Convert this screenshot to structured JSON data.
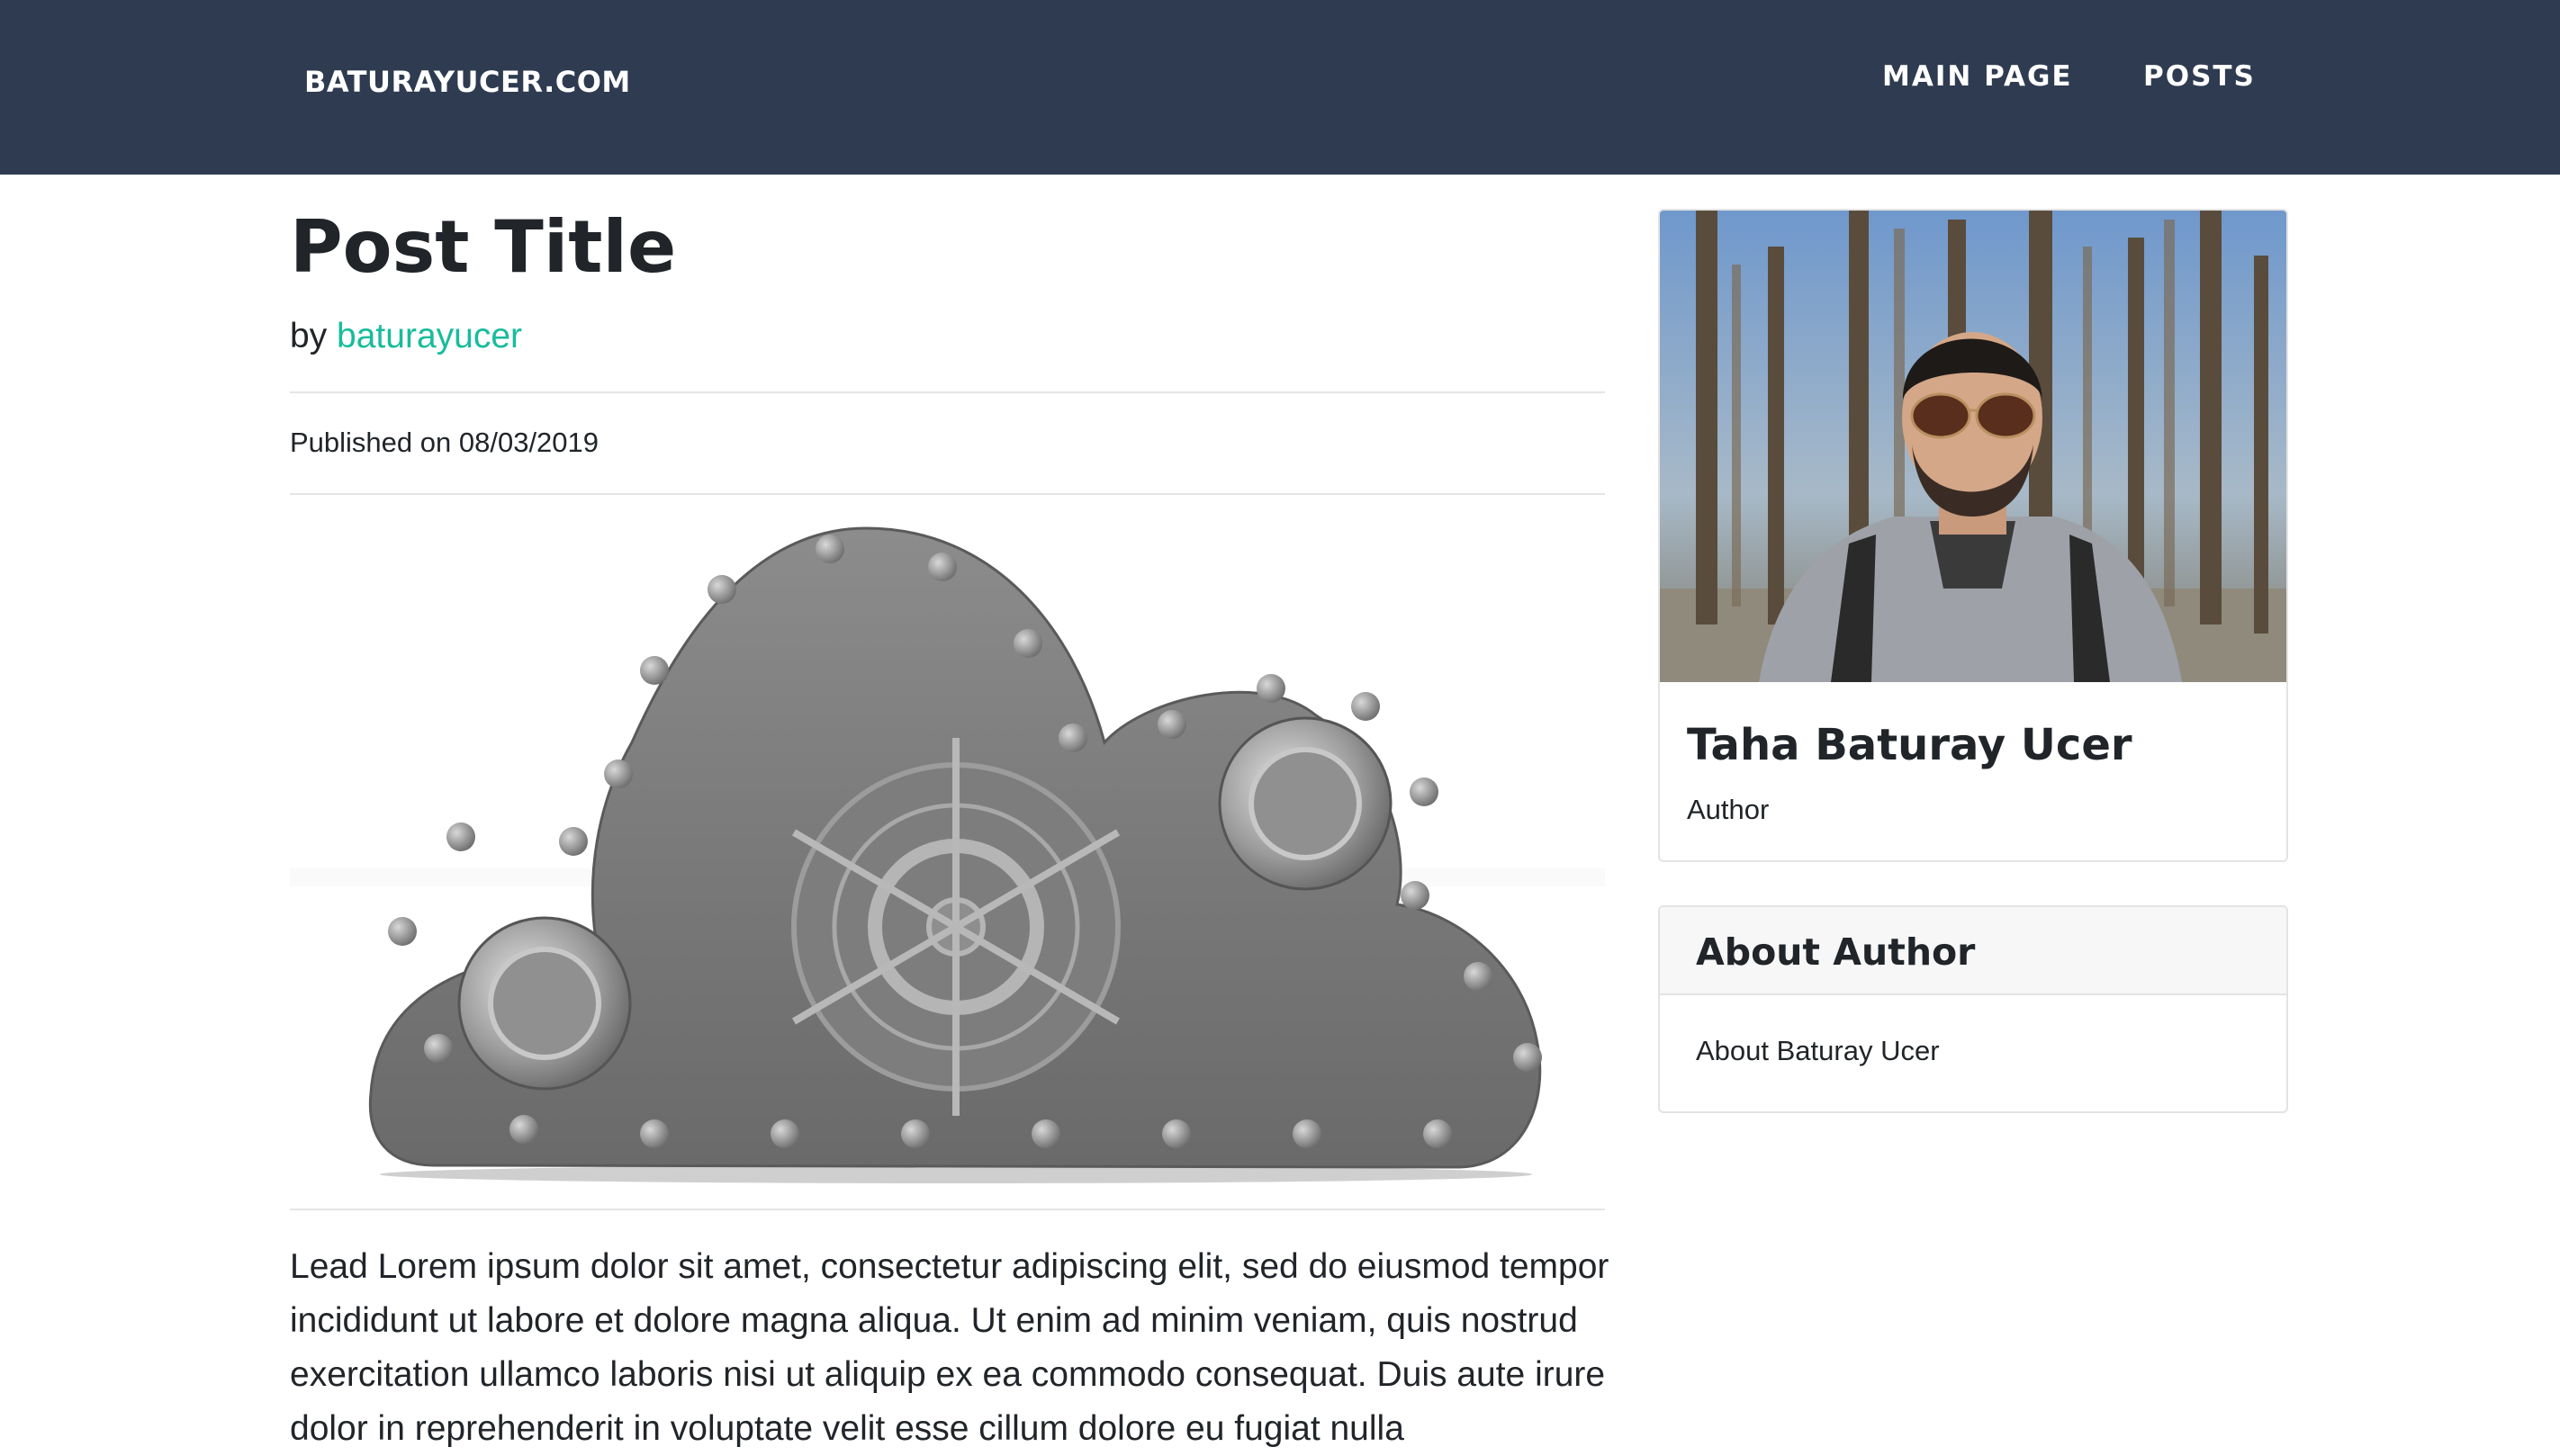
{
  "navbar": {
    "brand": "BATURAYUCER.COM",
    "links": [
      "MAIN PAGE",
      "POSTS"
    ],
    "background": "#2e3b50"
  },
  "post": {
    "title": "Post Title",
    "by_prefix": "by",
    "author_link": "baturayucer",
    "published": "Published on 08/03/2019",
    "image_icon": "metal-cloud-safe-image",
    "lead": "Lead Lorem ipsum dolor sit amet, consectetur adipiscing elit, sed do eiusmod tempor incididunt ut labore et dolore magna aliqua. Ut enim ad minim veniam, quis nostrud exercitation ullamco laboris nisi ut aliquip ex ea commodo consequat. Duis aute irure dolor in reprehenderit in voluptate velit esse cillum dolore eu fugiat nulla"
  },
  "sidebar": {
    "author_card": {
      "photo_icon": "author-photo",
      "name": "Taha Baturay Ucer",
      "role": "Author"
    },
    "about_card": {
      "title": "About Author",
      "body": "About Baturay Ucer"
    }
  },
  "colors": {
    "accent": "#18bc9c",
    "navbar": "#2e3b50",
    "text": "#212529"
  }
}
